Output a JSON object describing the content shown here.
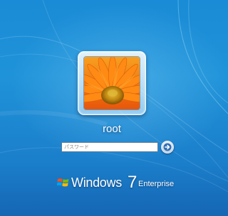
{
  "login": {
    "username": "root",
    "password_placeholder": "パスワード",
    "password_value": ""
  },
  "avatar": {
    "subject": "orange gerbera flower"
  },
  "branding": {
    "product": "Windows",
    "version": "7",
    "edition": "Enterprise"
  },
  "icons": {
    "submit": "arrow-right-icon",
    "logo": "windows-flag-icon"
  },
  "colors": {
    "background": "#1f93d9",
    "petal": "#f47a12",
    "flower_center": "#c99a1a",
    "text": "#ffffff"
  }
}
